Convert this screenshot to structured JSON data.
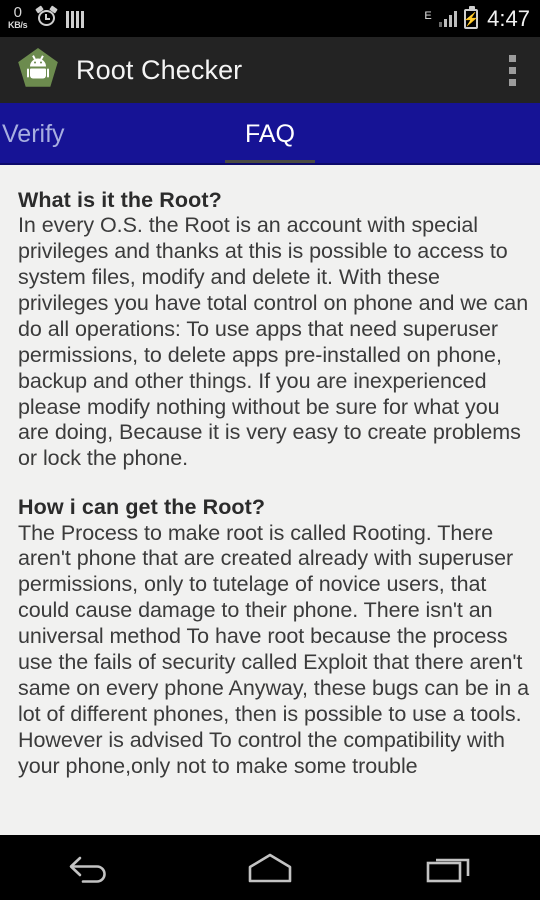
{
  "statusbar": {
    "network_speed_value": "0",
    "network_speed_unit": "KB/s",
    "alarm_icon": "alarm-clock-icon",
    "bars_icon": "equalizer-bars-icon",
    "network_type": "E",
    "signal_icon": "signal-bars-icon",
    "battery_icon": "battery-charging-icon",
    "battery_bolt": "⚡",
    "time": "4:47"
  },
  "appbar": {
    "logo_icon": "root-checker-android-logo",
    "title": "Root Checker",
    "overflow_icon": "overflow-menu-icon"
  },
  "tabs": [
    {
      "label": "Verify",
      "active": false
    },
    {
      "label": "FAQ",
      "active": true
    }
  ],
  "faq": {
    "sections": [
      {
        "heading": "What is it the Root?",
        "body": "In every O.S. the Root is an account with special privileges and thanks at this is possible to access to system files, modify and delete it. With these privileges you have total control on phone and we can do all operations: To use apps that need superuser permissions, to delete apps pre-installed on phone, backup and other things. If you are inexperienced please modify nothing without be sure for what you are doing, Because it is very easy to create problems or lock the phone."
      },
      {
        "heading": "How i can get the Root?",
        "body": "The Process to make root is called Rooting. There aren't phone that are created already with superuser permissions, only to tutelage of novice users, that could cause damage to their phone. There isn't an universal method To have root because the process use the fails of security called Exploit that there aren't same on every phone Anyway, these bugs can be in a lot of different phones, then is possible to use a tools. However is advised To control the compatibility with your phone,only not to make some trouble"
      }
    ]
  },
  "navbar": {
    "back": "back-nav-button",
    "home": "home-nav-button",
    "recents": "recents-nav-button"
  },
  "colors": {
    "statusbar_bg": "#000000",
    "appbar_bg": "#232323",
    "tabbar_bg": "#161395",
    "tab_indicator": "#4a4a42",
    "content_bg": "#f1f1f0",
    "logo_green": "#6c8b4e",
    "navbar_bg": "#000000"
  }
}
